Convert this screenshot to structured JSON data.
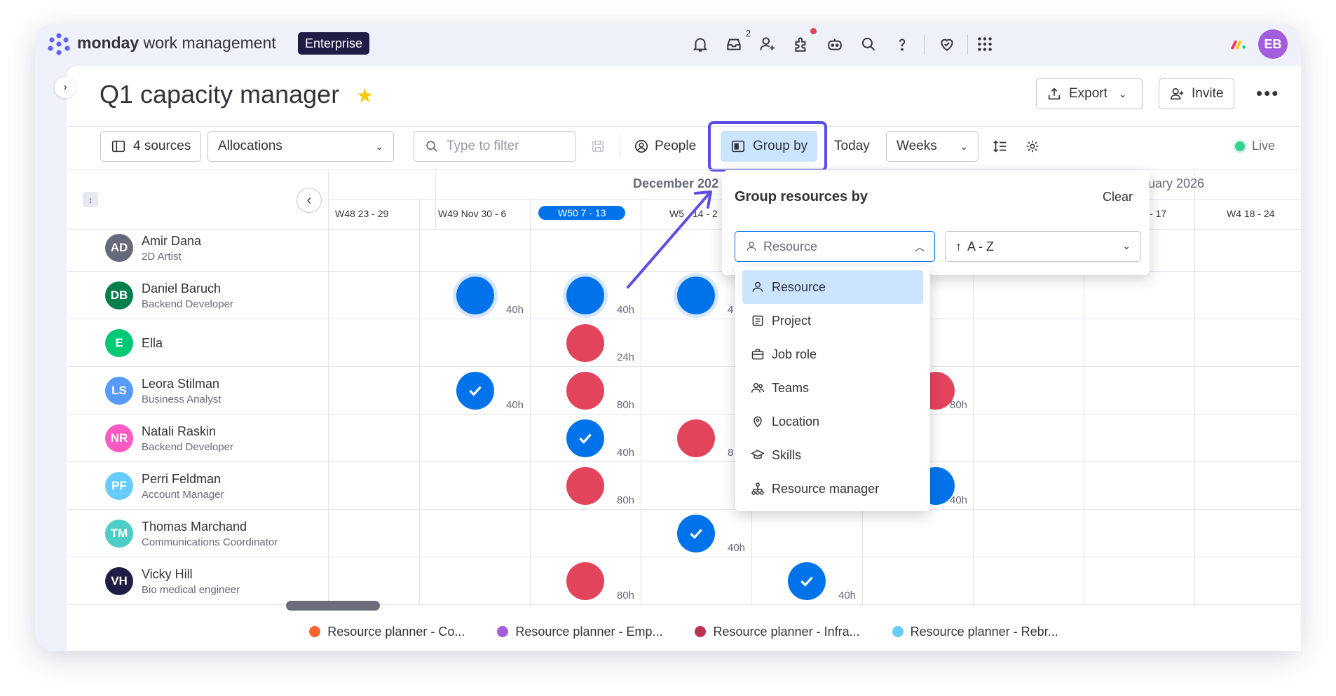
{
  "topbar": {
    "brand_bold": "monday",
    "brand_rest": " work management",
    "plan_badge": "Enterprise",
    "inbox_count": "2",
    "user_initials": "EB",
    "icons": [
      "bell-icon",
      "inbox-icon",
      "invite-members-icon",
      "apps-icon",
      "ai-bot-icon",
      "search-icon",
      "help-icon",
      "heart-icon",
      "app-grid-icon",
      "monday-logo-icon"
    ]
  },
  "board": {
    "title": "Q1 capacity manager",
    "favorite": true,
    "export_label": "Export",
    "invite_label": "Invite"
  },
  "toolbar": {
    "sources_label": "4 sources",
    "view_select": "Allocations",
    "filter_placeholder": "Type to filter",
    "people_label": "People",
    "groupby_label": "Group by",
    "today_label": "Today",
    "scale_select": "Weeks",
    "live_label": "Live"
  },
  "timeline": {
    "months": [
      "December 202",
      "uary 2026"
    ],
    "weeks": [
      "W48 23 - 29",
      "W49 Nov 30 - 6",
      "W50 7 - 13",
      "W5",
      "14 - 2",
      "- 17",
      "W4 18 - 24"
    ],
    "current_week": "W50 7 - 13"
  },
  "people": [
    {
      "initials": "AD",
      "name": "Amir Dana",
      "role": "2D Artist",
      "color": "#676879"
    },
    {
      "initials": "DB",
      "name": "Daniel Baruch",
      "role": "Backend Developer",
      "color": "#037f4c"
    },
    {
      "initials": "E",
      "name": "Ella",
      "role": "",
      "color": "#00c875"
    },
    {
      "initials": "LS",
      "name": "Leora Stilman",
      "role": "Business Analyst",
      "color": "#579bfc"
    },
    {
      "initials": "NR",
      "name": "Natali Raskin",
      "role": "Backend Developer",
      "color": "#ff5ac4"
    },
    {
      "initials": "PF",
      "name": "Perri Feldman",
      "role": "Account Manager",
      "color": "#66ccff"
    },
    {
      "initials": "TM",
      "name": "Thomas Marchand",
      "role": "Communications Coordinator",
      "color": "#4eccc6"
    },
    {
      "initials": "VH",
      "name": "Vicky Hill",
      "role": "Bio medical engineer",
      "color": "#1f1d45"
    }
  ],
  "allocations": {
    "db_w49": "40h",
    "db_w50": "40h",
    "db_w51": "4",
    "ella_w50": "24h",
    "ls_w49": "40h",
    "ls_w50": "80h",
    "ls_right": "80h",
    "nr_w50": "40h",
    "nr_w51": "8",
    "pf_w50": "80h",
    "pf_right": "40h",
    "tm_w51": "40h",
    "vh_w50": "80h",
    "vh_w52": "40h"
  },
  "groupby_panel": {
    "title": "Group resources by",
    "clear_label": "Clear",
    "selected": "Resource",
    "sort": "A - Z",
    "options": [
      {
        "label": "Resource",
        "icon": "person-icon"
      },
      {
        "label": "Project",
        "icon": "project-icon"
      },
      {
        "label": "Job role",
        "icon": "briefcase-icon"
      },
      {
        "label": "Teams",
        "icon": "team-icon"
      },
      {
        "label": "Location",
        "icon": "location-pin-icon"
      },
      {
        "label": "Skills",
        "icon": "graduation-cap-icon"
      },
      {
        "label": "Resource manager",
        "icon": "hierarchy-icon"
      }
    ]
  },
  "legend": [
    {
      "label": "Resource planner - Co...",
      "color": "#ff642e"
    },
    {
      "label": "Resource planner - Emp...",
      "color": "#a25ddc"
    },
    {
      "label": "Resource planner - Infra...",
      "color": "#bb3354"
    },
    {
      "label": "Resource planner - Rebr...",
      "color": "#66ccff"
    }
  ],
  "colors": {
    "accent": "#0073ea",
    "highlight": "#5c4ee5",
    "allocation_blue": "#0073ea",
    "allocation_red": "#e2445c"
  }
}
